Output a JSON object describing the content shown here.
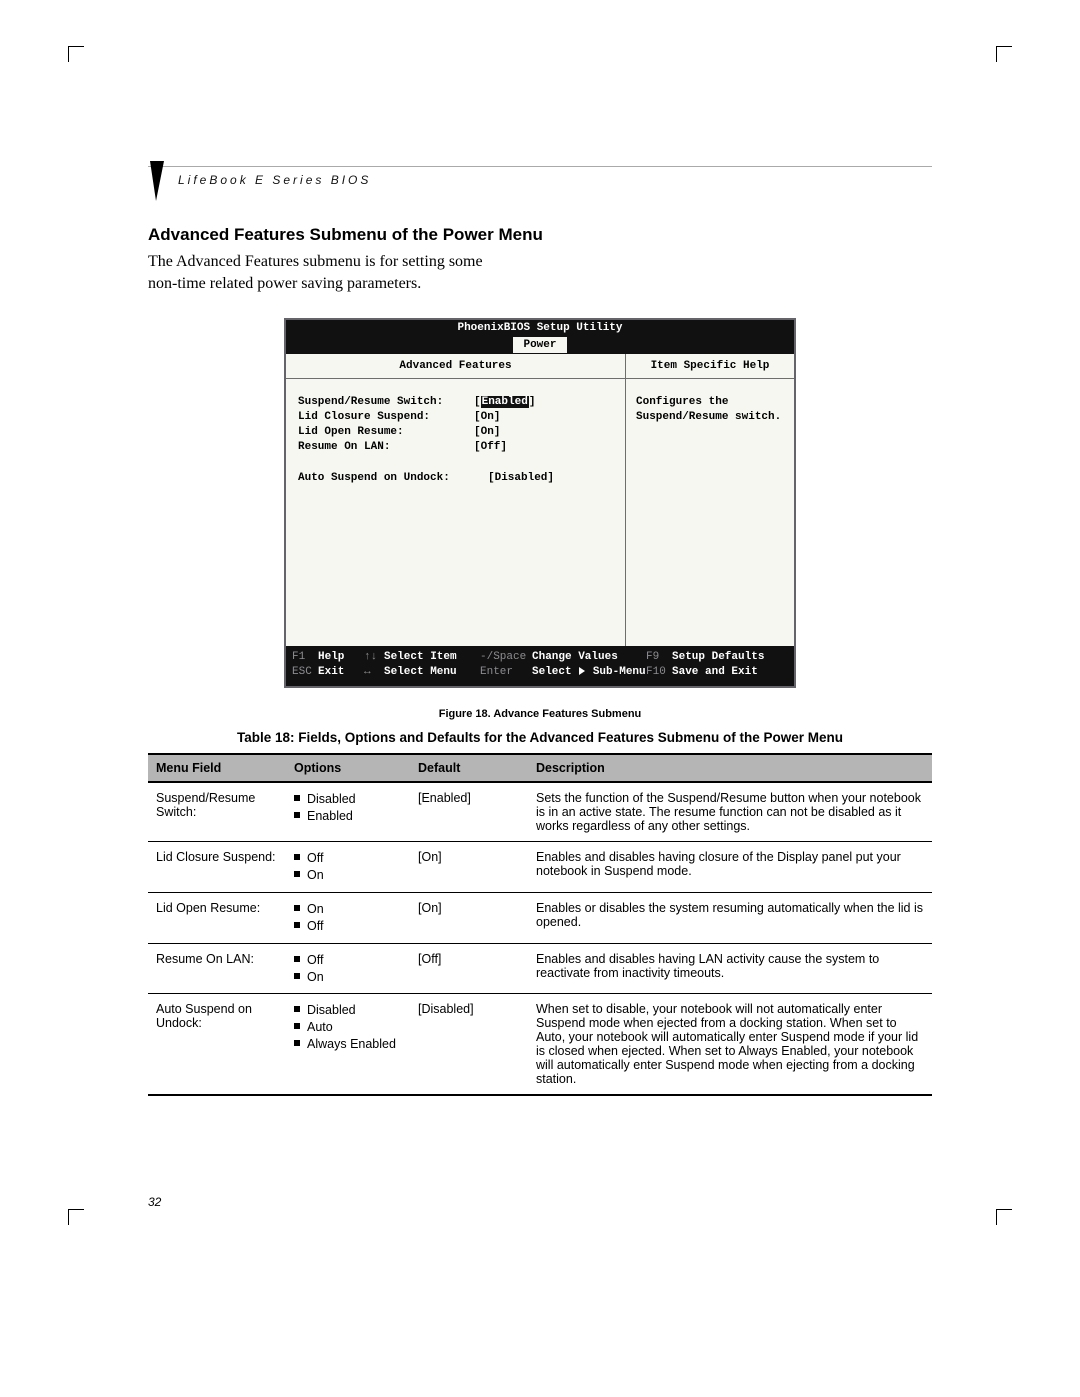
{
  "header": {
    "running": "LifeBook E Series BIOS"
  },
  "section": {
    "title": "Advanced Features Submenu of the Power Menu",
    "intro": "The Advanced Features submenu is for setting some non-time related power saving parameters."
  },
  "bios": {
    "title": "PhoenixBIOS Setup Utility",
    "active_tab": "Power",
    "left_title": "Advanced Features",
    "right_title": "Item Specific Help",
    "help_text": "Configures the Suspend/Resume switch.",
    "items": [
      {
        "label": "Suspend/Resume Switch:",
        "value": "Enabled",
        "selected": true
      },
      {
        "label": "Lid Closure Suspend:",
        "value": "[On]",
        "selected": false
      },
      {
        "label": "Lid Open Resume:",
        "value": "[On]",
        "selected": false
      },
      {
        "label": "Resume On LAN:",
        "value": "[Off]",
        "selected": false
      }
    ],
    "extra": {
      "label": "Auto Suspend on Undock:",
      "value": "[Disabled]"
    },
    "legend": {
      "r1": {
        "c1k": "F1",
        "c1v": "Help",
        "c2k": "↑↓",
        "c2v": "Select Item",
        "c3k": "-/Space",
        "c3v": "Change Values",
        "c4k": "F9",
        "c4v": "Setup Defaults"
      },
      "r2": {
        "c1k": "ESC",
        "c1v": "Exit",
        "c2k": "↔",
        "c2v": "Select Menu",
        "c3k": "Enter",
        "c3v_pre": "Select ",
        "c3v_post": " Sub-Menu",
        "c4k": "F10",
        "c4v": "Save and Exit"
      }
    }
  },
  "figure_caption": "Figure 18.  Advance Features Submenu",
  "table_title": "Table 18: Fields, Options and Defaults for the Advanced Features Submenu of the Power Menu",
  "table": {
    "headers": [
      "Menu Field",
      "Options",
      "Default",
      "Description"
    ],
    "rows": [
      {
        "field": "Suspend/Resume Switch:",
        "options": [
          "Disabled",
          "Enabled"
        ],
        "default": "[Enabled]",
        "desc": "Sets the function of the Suspend/Resume button when your notebook is in an active state. The resume function can not be disabled as it works regardless of any other settings."
      },
      {
        "field": "Lid Closure Suspend:",
        "options": [
          "Off",
          "On"
        ],
        "default": "[On]",
        "desc": "Enables and disables having closure of the Display panel put your notebook in Suspend mode."
      },
      {
        "field": "Lid Open Resume:",
        "options": [
          "On",
          "Off"
        ],
        "default": "[On]",
        "desc": "Enables or disables the system resuming automatically when the lid is opened."
      },
      {
        "field": "Resume On LAN:",
        "options": [
          "Off",
          "On"
        ],
        "default": "[Off]",
        "desc": "Enables and disables having LAN activity cause the system to reactivate from inactivity timeouts."
      },
      {
        "field": "Auto Suspend on Undock:",
        "options": [
          "Disabled",
          "Auto",
          "Always Enabled"
        ],
        "default": "[Disabled]",
        "desc": "When set to disable, your notebook will not automatically enter Suspend mode when ejected from a docking station. When set to Auto, your notebook will automatically enter Suspend mode if your lid is closed when ejected. When set to Always Enabled, your notebook will automatically enter Suspend mode when ejecting from a docking station."
      }
    ]
  },
  "page_number": "32"
}
